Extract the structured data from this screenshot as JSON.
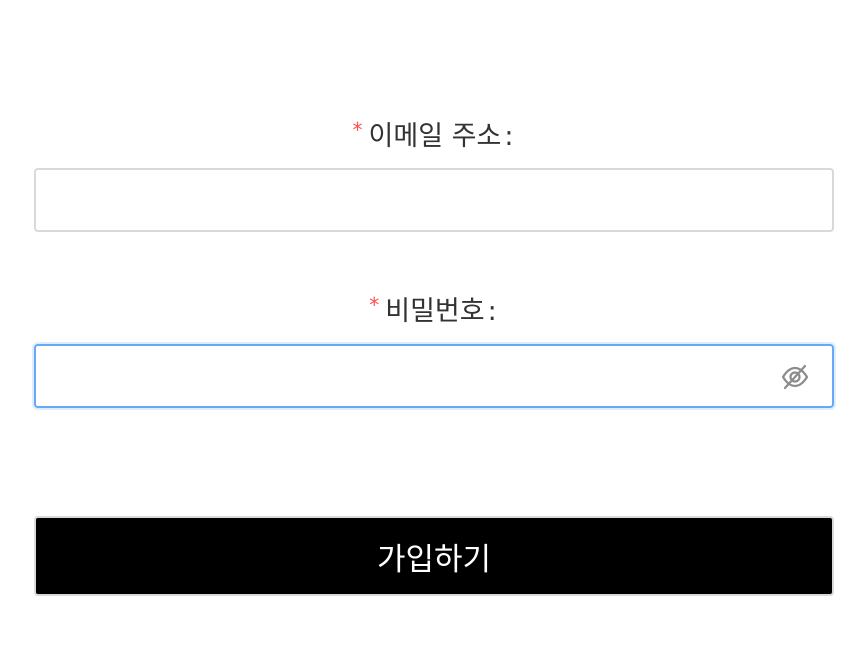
{
  "form": {
    "email": {
      "required_mark": "*",
      "label": "이메일 주소",
      "colon": ":",
      "value": "",
      "placeholder": ""
    },
    "password": {
      "required_mark": "*",
      "label": "비밀번호",
      "colon": ":",
      "value": "",
      "placeholder": "",
      "visibility_icon": "eye-invisible-icon"
    },
    "submit_label": "가입하기"
  },
  "colors": {
    "required": "#ff4d4f",
    "focus_border": "#6aa8f7",
    "button_bg": "#000000",
    "button_text": "#ffffff"
  }
}
